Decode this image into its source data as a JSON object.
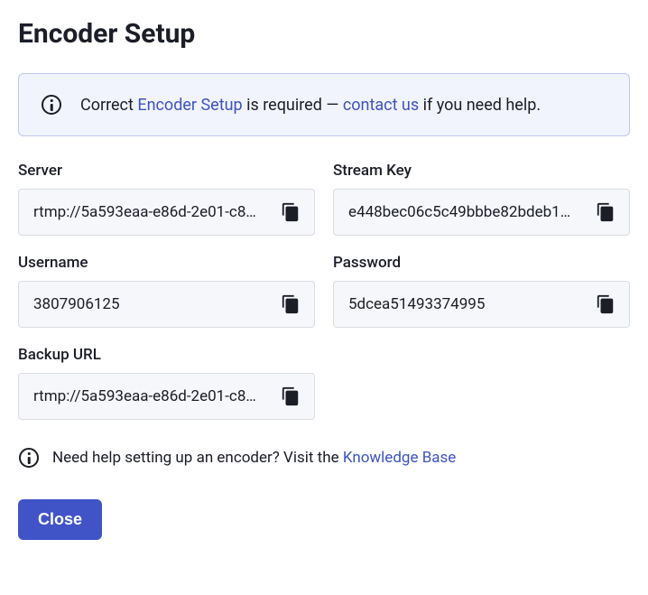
{
  "title": "Encoder Setup",
  "banner": {
    "prefix": "Correct ",
    "link1": "Encoder Setup",
    "middle": " is required — ",
    "link2": "contact us",
    "suffix": " if you need help."
  },
  "fields": {
    "server": {
      "label": "Server",
      "value": "rtmp://5a593eaa-e86d-2e01-c8…"
    },
    "stream_key": {
      "label": "Stream Key",
      "value": "e448bec06c5c49bbbe82bdeb1…"
    },
    "username": {
      "label": "Username",
      "value": "3807906125"
    },
    "password": {
      "label": "Password",
      "value": "5dcea51493374995"
    },
    "backup_url": {
      "label": "Backup URL",
      "value": "rtmp://5a593eaa-e86d-2e01-c8…"
    }
  },
  "help": {
    "text": "Need help setting up an encoder? Visit the ",
    "link": "Knowledge Base"
  },
  "close_label": "Close"
}
